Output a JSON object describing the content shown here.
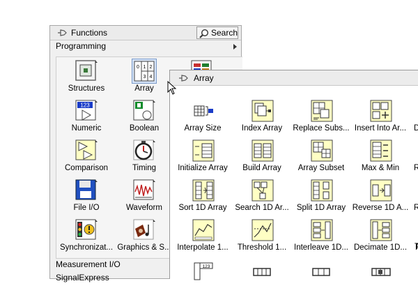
{
  "functions": {
    "title": "Functions",
    "search_label": "Search",
    "programming": "Programming",
    "items": [
      {
        "label": "Structures"
      },
      {
        "label": "Array"
      },
      {
        "label": "Numeric"
      },
      {
        "label": "Boolean"
      },
      {
        "label": "Comparison"
      },
      {
        "label": "Timing"
      },
      {
        "label": "File I/O"
      },
      {
        "label": "Waveform"
      },
      {
        "label": "Synchronizat..."
      },
      {
        "label": "Graphics & S..."
      }
    ],
    "numeric_icon_text": "123",
    "array_icon_cells": [
      "0",
      "1",
      "2",
      "3",
      "4"
    ],
    "measurement": "Measurement I/O",
    "signal": "SignalExpress"
  },
  "array": {
    "title": "Array",
    "items": [
      {
        "label": "Array Size"
      },
      {
        "label": "Index Array"
      },
      {
        "label": "Replace Subs..."
      },
      {
        "label": "Insert Into Ar..."
      },
      {
        "label": "Initialize Array"
      },
      {
        "label": "Build Array"
      },
      {
        "label": "Array Subset"
      },
      {
        "label": "Max & Min"
      },
      {
        "label": "Sort 1D Array"
      },
      {
        "label": "Search 1D Ar..."
      },
      {
        "label": "Split 1D Array"
      },
      {
        "label": "Reverse 1D A..."
      },
      {
        "label": "Interpolate 1..."
      },
      {
        "label": "Threshold 1..."
      },
      {
        "label": "Interleave 1D..."
      },
      {
        "label": "Decimate 1D..."
      }
    ],
    "edge_labels": [
      "D",
      "R",
      "R",
      "R",
      "T"
    ],
    "row5_icon_text": "123"
  },
  "colors": {
    "icon_yellow": "#ffffc4",
    "numeric_blue": "#1a3cc8",
    "boolean_green": "#0c8a2a",
    "selection": "#d6e4f8"
  }
}
